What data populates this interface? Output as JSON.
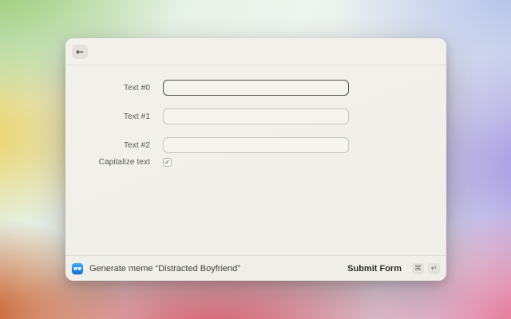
{
  "window": {
    "titlebar": {
      "back_icon_glyph": "←"
    },
    "form": {
      "fields": [
        {
          "label": "Text #0",
          "value": "",
          "focused": true
        },
        {
          "label": "Text #1",
          "value": "",
          "focused": false
        },
        {
          "label": "Text #2",
          "value": "",
          "focused": false
        }
      ],
      "checkbox": {
        "label": "Capitalize text",
        "checked": true,
        "check_glyph": "✓"
      }
    },
    "footer": {
      "status_text": "Generate meme “Distracted Boyfriend”",
      "submit_label": "Submit Form",
      "shortcut_keys": [
        "⌘",
        "↵"
      ]
    }
  },
  "colors": {
    "window_bg": "#f1efe9",
    "input_bg": "#f5f4ef",
    "input_border": "#c7c5bf",
    "input_border_focused": "#51504b",
    "app_icon_blue": "#1e88e0"
  }
}
